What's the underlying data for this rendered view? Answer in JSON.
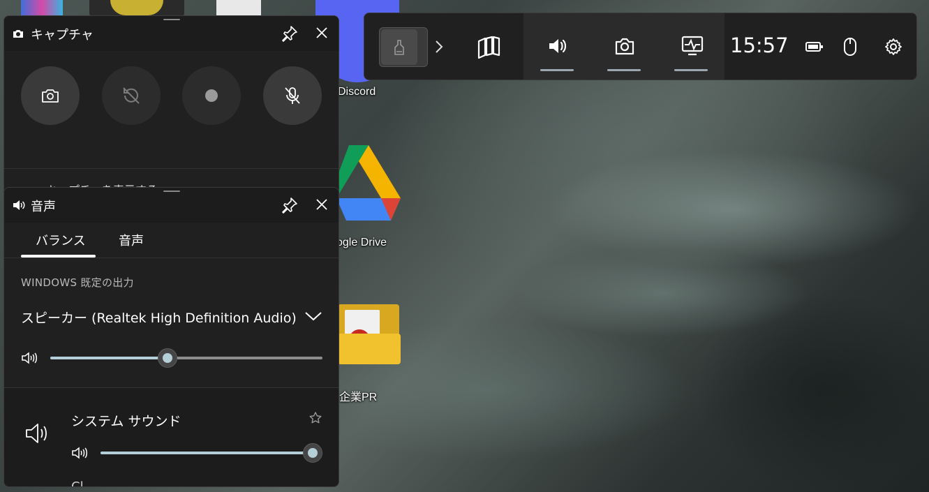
{
  "desktop": {
    "icons": [
      {
        "label": "Discord"
      },
      {
        "label": "ogle Drive"
      },
      {
        "label": "企業PR"
      }
    ]
  },
  "gamebar": {
    "time": "15:57",
    "icons": [
      "game-thumbnail-icon",
      "chevron-right-icon",
      "widget-store-icon",
      "audio-icon",
      "capture-icon",
      "performance-icon",
      "battery-icon",
      "mouse-icon",
      "settings-gear-icon"
    ]
  },
  "capture": {
    "title": "キャプチャ",
    "show_all": "キャプチャを表示する",
    "buttons": [
      "screenshot",
      "record-last",
      "start-recording",
      "mic-off"
    ]
  },
  "audio": {
    "title": "音声",
    "tabs": [
      {
        "label": "バランス",
        "active": true
      },
      {
        "label": "音声",
        "active": false
      }
    ],
    "section_label": "WINDOWS 既定の出力",
    "device": "スピーカー (Realtek High Definition Audio)",
    "master_volume": 0.43,
    "app_name": "システム サウンド",
    "app_volume": 1.0,
    "next_app_partial": "Cl"
  },
  "colors": {
    "panel": "#202020",
    "accent": "#b5cfd9",
    "discord": "#5865f2"
  }
}
